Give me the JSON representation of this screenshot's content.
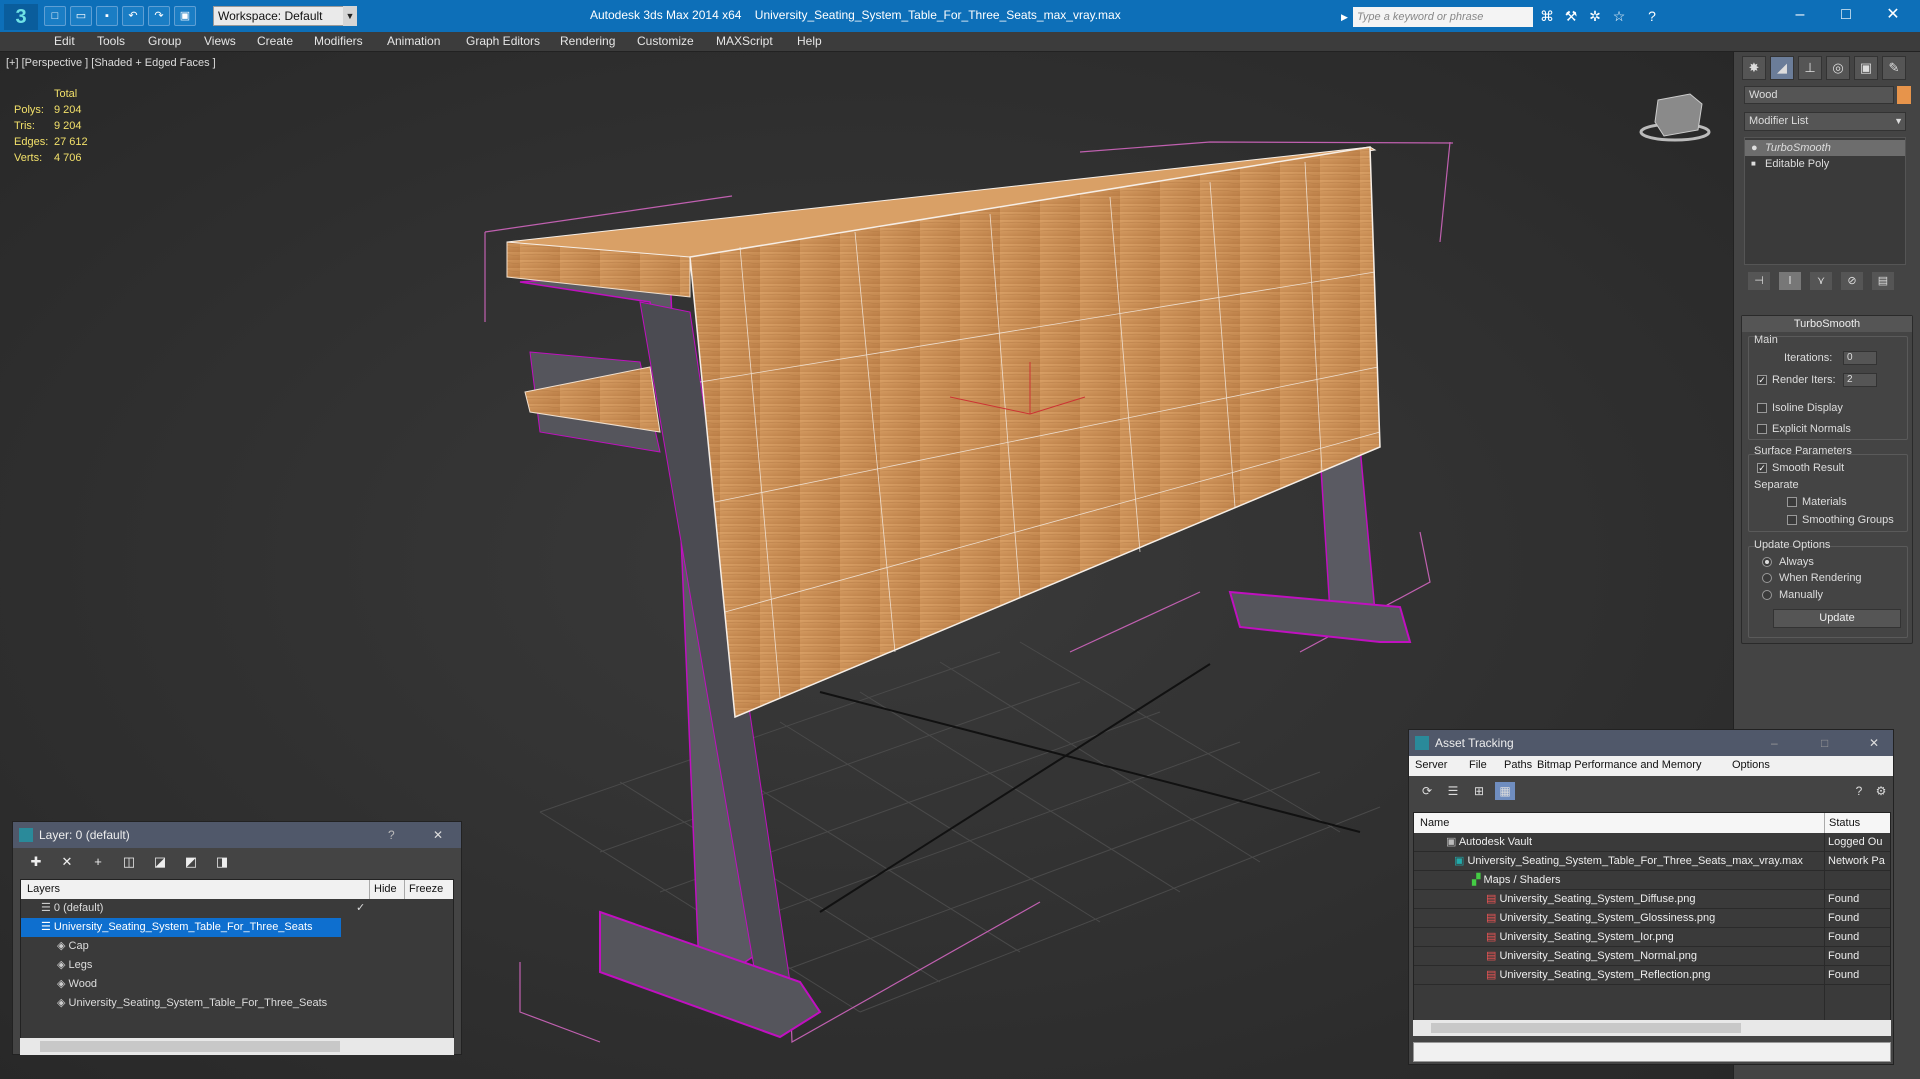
{
  "app": {
    "title": "Autodesk 3ds Max  2014 x64",
    "file": "University_Seating_System_Table_For_Three_Seats_max_vray.max",
    "workspace": "Workspace: Default",
    "search_placeholder": "Type a keyword or phrase"
  },
  "menu": [
    "Edit",
    "Tools",
    "Group",
    "Views",
    "Create",
    "Modifiers",
    "Animation",
    "Graph Editors",
    "Rendering",
    "Customize",
    "MAXScript",
    "Help"
  ],
  "viewport": {
    "label": "[+] [Perspective ] [Shaded + Edged Faces ]",
    "stats": {
      "header": "Total",
      "rows": [
        {
          "label": "Polys:",
          "value": "9 204"
        },
        {
          "label": "Tris:",
          "value": "9 204"
        },
        {
          "label": "Edges:",
          "value": "27 612"
        },
        {
          "label": "Verts:",
          "value": "4 706"
        }
      ]
    }
  },
  "command_panel": {
    "object_name": "Wood",
    "object_color": "#e7944b",
    "modifier_list": "Modifier List",
    "stack": [
      "TurboSmooth",
      "Editable Poly"
    ],
    "rollout_title": "TurboSmooth",
    "main_label": "Main",
    "iterations_label": "Iterations:",
    "iterations_value": "0",
    "render_iters_label": "Render Iters:",
    "render_iters_value": "2",
    "isoline": "Isoline Display",
    "explicit": "Explicit Normals",
    "surface_label": "Surface Parameters",
    "smooth_result": "Smooth Result",
    "separate_label": "Separate",
    "materials": "Materials",
    "smoothing_groups": "Smoothing Groups",
    "update_options": "Update Options",
    "always": "Always",
    "when_rendering": "When Rendering",
    "manually": "Manually",
    "update_button": "Update"
  },
  "layer_window": {
    "title": "Layer: 0 (default)",
    "columns": {
      "layers": "Layers",
      "hide": "Hide",
      "freeze": "Freeze"
    },
    "rows": [
      {
        "name": "0 (default)"
      },
      {
        "name": "University_Seating_System_Table_For_Three_Seats"
      },
      {
        "name": "Cap"
      },
      {
        "name": "Legs"
      },
      {
        "name": "Wood"
      },
      {
        "name": "University_Seating_System_Table_For_Three_Seats"
      }
    ]
  },
  "asset_window": {
    "title": "Asset Tracking",
    "menu": [
      "Server",
      "File",
      "Paths",
      "Bitmap Performance and Memory",
      "Options"
    ],
    "columns": {
      "name": "Name",
      "status": "Status"
    },
    "rows": [
      {
        "name": "Autodesk Vault",
        "status": "Logged Ou"
      },
      {
        "name": "University_Seating_System_Table_For_Three_Seats_max_vray.max",
        "status": "Network Pa"
      },
      {
        "name": "Maps / Shaders",
        "status": ""
      },
      {
        "name": "University_Seating_System_Diffuse.png",
        "status": "Found"
      },
      {
        "name": "University_Seating_System_Glossiness.png",
        "status": "Found"
      },
      {
        "name": "University_Seating_System_Ior.png",
        "status": "Found"
      },
      {
        "name": "University_Seating_System_Normal.png",
        "status": "Found"
      },
      {
        "name": "University_Seating_System_Reflection.png",
        "status": "Found"
      }
    ]
  }
}
